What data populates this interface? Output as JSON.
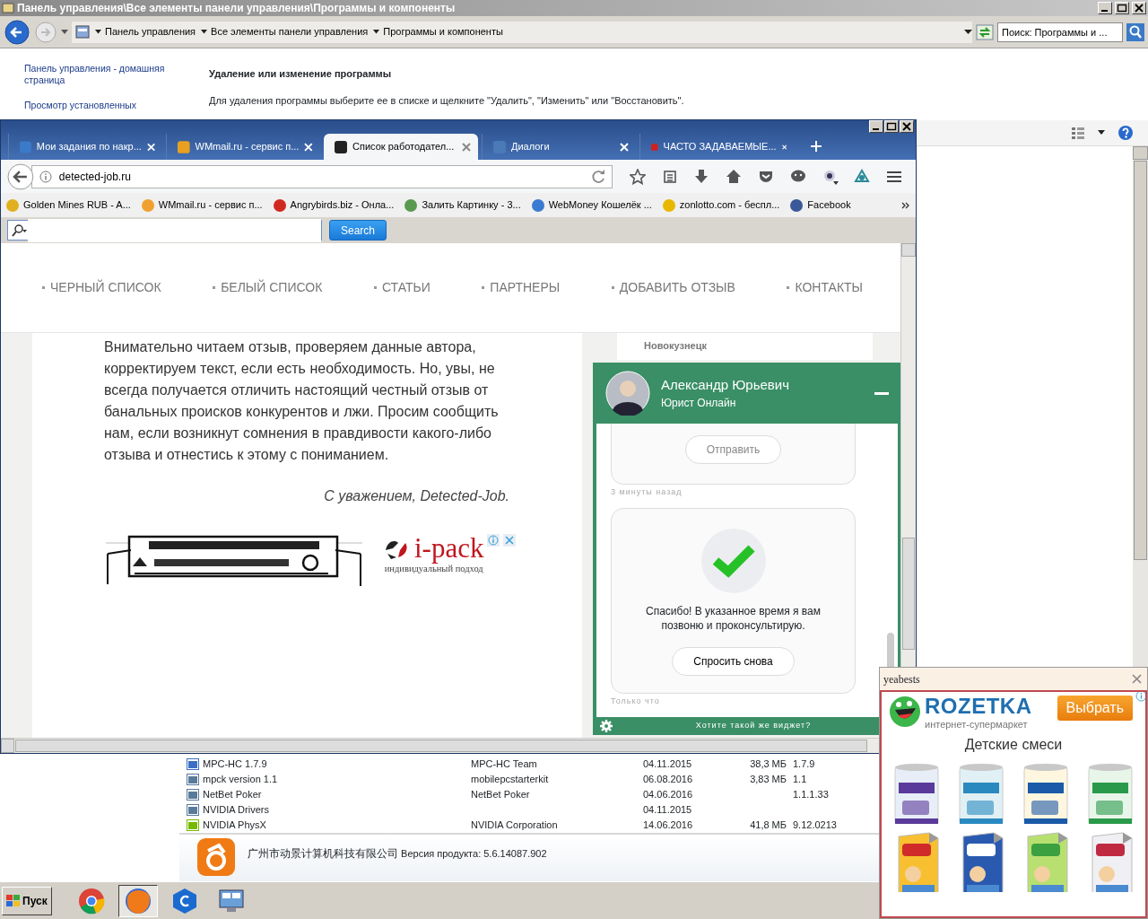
{
  "control_panel": {
    "title": "Панель управления\\Все элементы панели управления\\Программы и компоненты",
    "breadcrumbs": [
      "Панель управления",
      "Все элементы панели управления",
      "Программы и компоненты"
    ],
    "search": {
      "placeholder": "Поиск: Программы и ..."
    },
    "sidebar_links": [
      "Панель управления - домашняя страница",
      "Просмотр установленных"
    ],
    "heading": "Удаление или изменение программы",
    "description": "Для удаления программы выберите ее в списке и щелкните \"Удалить\", \"Изменить\" или \"Восстановить\".",
    "programs": [
      {
        "name": "MPC-HC 1.7.9",
        "publisher": "MPC-HC Team",
        "installed": "04.11.2015",
        "size": "38,3 МБ",
        "version": "1.7.9",
        "color": "#3a6fc4"
      },
      {
        "name": "mpck version 1.1",
        "publisher": "mobilepcstarterkit",
        "installed": "06.08.2016",
        "size": "3,83 МБ",
        "version": "1.1",
        "color": "#5a7a9a"
      },
      {
        "name": "NetBet Poker",
        "publisher": "NetBet Poker",
        "installed": "04.06.2016",
        "version": "1.1.1.33",
        "color": "#5a7a9a"
      },
      {
        "name": "NVIDIA Drivers",
        "installed": "04.11.2015",
        "color": "#5a7a9a"
      },
      {
        "name": "NVIDIA PhysX",
        "publisher": "NVIDIA Corporation",
        "installed": "14.06.2016",
        "size": "41,8 МБ",
        "version": "9.12.0213",
        "color": "#76b900"
      }
    ],
    "details": {
      "publisher": "广州市动景计算机科技有限公司",
      "version_label": "Версия продукта:",
      "version": "5.6.14087.902"
    }
  },
  "browser": {
    "tabs": [
      {
        "title": "Мои задания по накр...",
        "selected": false,
        "color": "#3b7ac9"
      },
      {
        "title": "WMmail.ru - сервис п...",
        "selected": false,
        "color": "#e8a020"
      },
      {
        "title": "Список работодател...",
        "selected": true,
        "color": "#222222"
      },
      {
        "title": "Диалоги",
        "selected": false,
        "color": "#4a7ab8"
      },
      {
        "title": "ЧАСТО ЗАДАВАЕМЫЕ...",
        "selected": false,
        "color": "#d02020"
      }
    ],
    "address": "detected-job.ru",
    "bookmarks": [
      {
        "title": "Golden Mines RUB - A...",
        "color": "#e0b020"
      },
      {
        "title": "WMmail.ru - сервис п...",
        "color": "#f0a030"
      },
      {
        "title": "Angrybirds.biz - Онла...",
        "color": "#d02a20"
      },
      {
        "title": "Залить Картинку - 3...",
        "color": "#5a9a50"
      },
      {
        "title": "WebMoney Кошелёк ...",
        "color": "#3a7ad0"
      },
      {
        "title": "zonlotto.com - беспл...",
        "color": "#e8b800"
      },
      {
        "title": "Facebook",
        "color": "#3b5998"
      }
    ],
    "search_button": "Search",
    "site": {
      "nav": [
        "ЧЕРНЫЙ СПИСОК",
        "БЕЛЫЙ СПИСОК",
        "СТАТЬИ",
        "ПАРТНЕРЫ",
        "ДОБАВИТЬ ОТЗЫВ",
        "КОНТАКТЫ"
      ],
      "paragraph": "Внимательно читаем отзыв, проверяем данные автора, корректируем текст, если есть необходимость. Но, увы, не всегда получается отличить настоящий честный отзыв от банальных происков конкурентов и лжи. Просим сообщить нам, если возникнут сомнения в правдивости какого-либо отзыва и отнестись к этому с пониманием.",
      "signature": "С уважением, Detected-Job.",
      "ad_brand": "i-pack",
      "ad_tagline": "индивидуальный подход",
      "sidebar_city": "Новокузнецк"
    },
    "chat": {
      "name": "Александр Юрьевич",
      "role": "Юрист Онлайн",
      "messages": [
        {
          "kind": "form",
          "button": "Отправить",
          "time": "3 минуты назад"
        },
        {
          "kind": "confirmation",
          "text": "Спасибо! В указанное время я вам позвоню и проконсультирую.",
          "button": "Спросить снова",
          "time": "Только что"
        }
      ],
      "footer": "Хотите такой же виджет?"
    }
  },
  "ad_popup": {
    "source": "yeabests",
    "brand": "ROZETKA",
    "tagline": "интернет-супермаркет",
    "button": "Выбрать",
    "category": "Детские смеси"
  },
  "taskbar": {
    "start": "Пуск",
    "apps": [
      {
        "kind": "chrome",
        "selected": false
      },
      {
        "kind": "firefox",
        "selected": true
      },
      {
        "kind": "hexagon",
        "selected": false
      },
      {
        "kind": "monitor",
        "selected": false
      }
    ]
  }
}
